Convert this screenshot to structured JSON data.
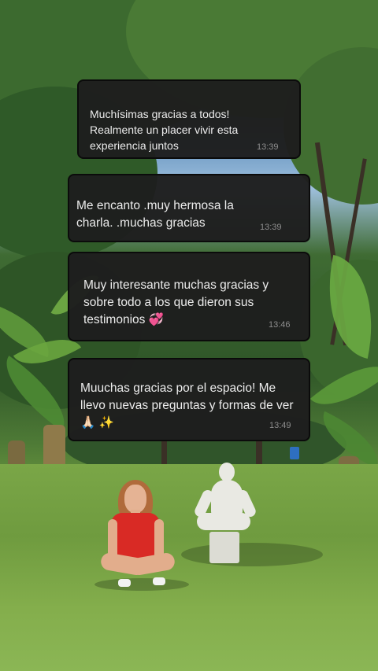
{
  "messages": [
    {
      "text": "Muchísimas gracias a todos! Realmente un placer vivir esta experiencia juntos",
      "time": "13:39"
    },
    {
      "text": "Me encanto .muy hermosa la charla. .muchas gracias",
      "time": "13:39"
    },
    {
      "text": "Muy interesante muchas gracias y sobre todo a los que dieron sus testimonios 💞",
      "time": "13:46"
    },
    {
      "text": "Muuchas gracias por el espacio! Me llevo nuevas preguntas y formas de ver 🙏🏻 ✨",
      "time": "13:49"
    }
  ],
  "colors": {
    "card_bg": "#1e1e1e",
    "text": "#ececec",
    "time": "#8e8e8e",
    "shirt": "#d92a25"
  }
}
